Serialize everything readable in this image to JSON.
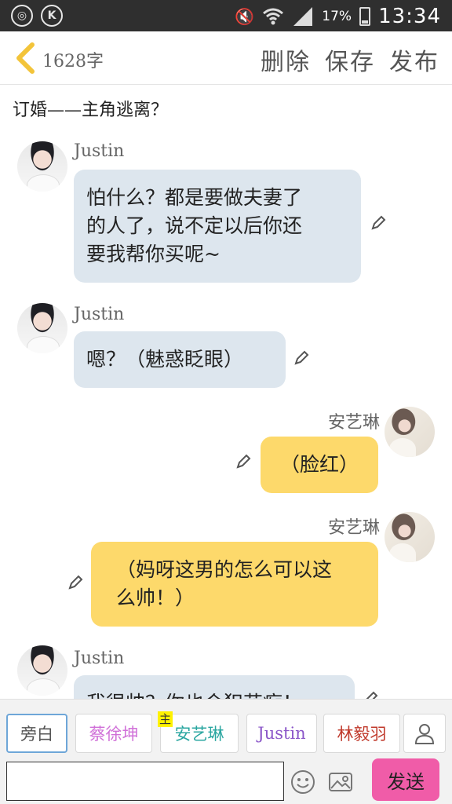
{
  "status": {
    "battery": "17%",
    "time": "13:34",
    "left_icons": [
      "weibo-icon",
      "k-icon"
    ]
  },
  "header": {
    "word_count": "1628字",
    "delete_label": "删除",
    "save_label": "保存",
    "publish_label": "发布"
  },
  "subject": "订婚——主角逃离？",
  "messages": [
    {
      "side": "left",
      "name": "Justin",
      "lines": [
        "怕什么？都是要做夫妻了",
        "的人了，说不定以后你还",
        "要我帮你买呢~"
      ]
    },
    {
      "side": "left",
      "name": "Justin",
      "lines": [
        "嗯？（魅惑眨眼）"
      ]
    },
    {
      "side": "right",
      "name": "安艺琳",
      "lines": [
        "（脸红）"
      ]
    },
    {
      "side": "right",
      "name": "安艺琳",
      "lines": [
        "（妈呀这男的怎么可以这",
        "么帅！）"
      ]
    },
    {
      "side": "left",
      "name": "Justin",
      "lines": [
        "我很帅？你也会犯花痴！"
      ]
    }
  ],
  "roles": [
    {
      "label": "旁白",
      "color": "#555555"
    },
    {
      "label": "蔡徐坤",
      "color": "#d070d8"
    },
    {
      "label": "安艺琳",
      "color": "#2aa6a0",
      "tag": "主"
    },
    {
      "label": "Justin",
      "color": "#8a55c8"
    },
    {
      "label": "林毅羽",
      "color": "#c0392b"
    }
  ],
  "input": {
    "value": "",
    "send_label": "发送"
  },
  "colors": {
    "left_bubble": "#dde6ee",
    "right_bubble": "#fdd96b",
    "send_button": "#f05ca8",
    "back_arrow": "#f3c43a"
  }
}
